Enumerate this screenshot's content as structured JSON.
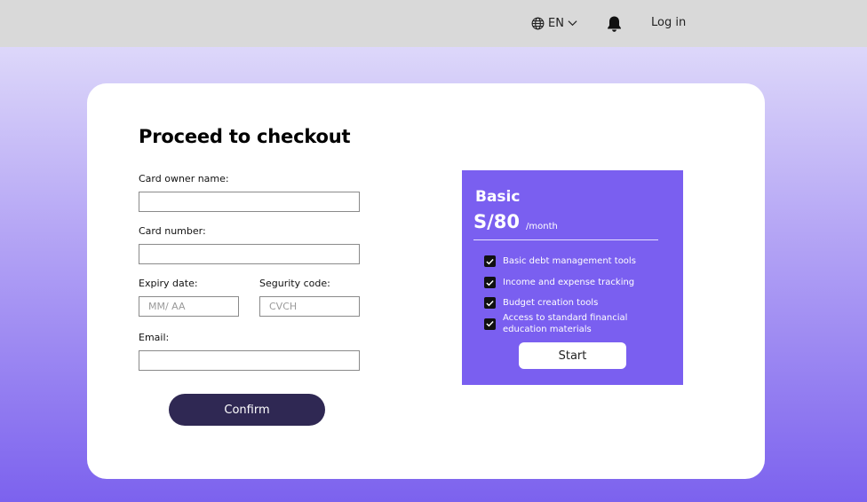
{
  "header": {
    "language": "EN",
    "login_label": "Log in"
  },
  "checkout": {
    "title": "Proceed to checkout",
    "fields": {
      "card_owner_label": "Card owner name:",
      "card_number_label": "Card number:",
      "expiry_label": "Expiry date:",
      "expiry_placeholder": "MM/ AA",
      "security_label": "Segurity code:",
      "security_placeholder": "CVCH",
      "email_label": "Email:"
    },
    "confirm_label": "Confirm"
  },
  "plan": {
    "name": "Basic",
    "price": "S/80",
    "period": "/month",
    "features": [
      "Basic debt management tools",
      "Income and expense tracking",
      "Budget creation tools",
      "Access to standard financial education materials"
    ],
    "start_label": "Start"
  },
  "colors": {
    "plan_background": "#7a5ff0",
    "confirm_button": "#2f2853",
    "topbar": "#d9d9d9"
  },
  "icons": [
    "globe-icon",
    "chevron-down-icon",
    "bell-icon",
    "check-icon"
  ]
}
